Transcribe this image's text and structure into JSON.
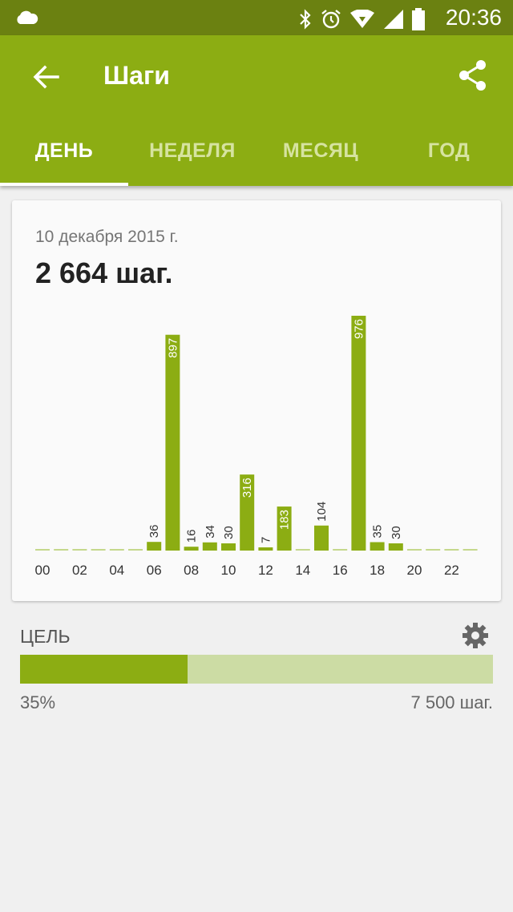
{
  "status_bar": {
    "time": "20:36",
    "icons": [
      "cloud-icon",
      "bluetooth-icon",
      "alarm-icon",
      "wifi-icon",
      "signal-icon",
      "battery-icon"
    ]
  },
  "app_bar": {
    "title": "Шаги",
    "back_icon": "arrow-back-icon",
    "share_icon": "share-icon",
    "color": "#8cad13"
  },
  "tabs": [
    {
      "label": "ДЕНЬ",
      "active": true
    },
    {
      "label": "НЕДЕЛЯ",
      "active": false
    },
    {
      "label": "МЕСЯЦ",
      "active": false
    },
    {
      "label": "ГОД",
      "active": false
    }
  ],
  "card": {
    "date": "10 декабря 2015 г.",
    "total": "2 664 шаг."
  },
  "chart_data": {
    "type": "bar",
    "categories": [
      "00",
      "01",
      "02",
      "03",
      "04",
      "05",
      "06",
      "07",
      "08",
      "09",
      "10",
      "11",
      "12",
      "13",
      "14",
      "15",
      "16",
      "17",
      "18",
      "19",
      "20",
      "21",
      "22",
      "23"
    ],
    "tick_labels": [
      "00",
      "02",
      "04",
      "06",
      "08",
      "10",
      "12",
      "14",
      "16",
      "18",
      "20",
      "22"
    ],
    "values": [
      0,
      0,
      0,
      0,
      0,
      0,
      36,
      897,
      16,
      34,
      30,
      316,
      7,
      183,
      0,
      104,
      0,
      976,
      35,
      30,
      0,
      0,
      0,
      0
    ],
    "ylim": [
      0,
      976
    ],
    "bar_color": "#8cad13",
    "grid": false
  },
  "goal": {
    "label": "ЦЕЛЬ",
    "percent_text": "35%",
    "progress": 0.355,
    "target_text": "7 500 шаг.",
    "gear_icon": "gear-icon"
  }
}
